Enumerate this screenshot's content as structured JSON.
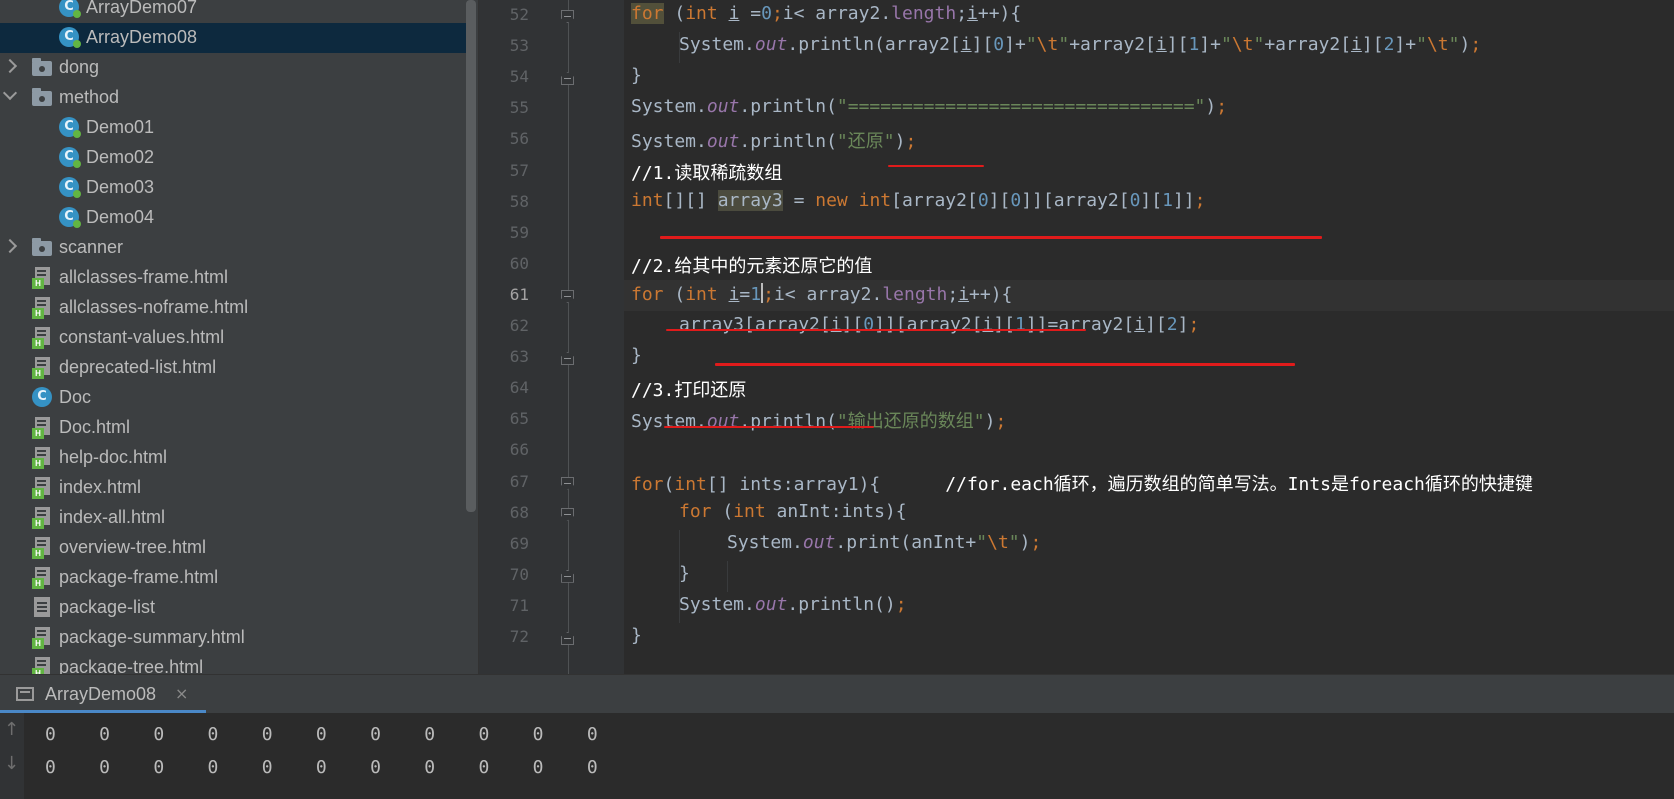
{
  "project_tree": [
    {
      "label": "ArrayDemo07",
      "type": "class",
      "indent": 2,
      "selected": false
    },
    {
      "label": "ArrayDemo08",
      "type": "class",
      "indent": 2,
      "selected": true
    },
    {
      "label": "dong",
      "type": "package",
      "indent": 1,
      "expanded": false
    },
    {
      "label": "method",
      "type": "package",
      "indent": 1,
      "expanded": true
    },
    {
      "label": "Demo01",
      "type": "class",
      "indent": 2
    },
    {
      "label": "Demo02",
      "type": "class",
      "indent": 2
    },
    {
      "label": "Demo03",
      "type": "class",
      "indent": 2
    },
    {
      "label": "Demo04",
      "type": "class",
      "indent": 2
    },
    {
      "label": "scanner",
      "type": "package",
      "indent": 1,
      "expanded": false
    },
    {
      "label": "allclasses-frame.html",
      "type": "html",
      "indent": 1
    },
    {
      "label": "allclasses-noframe.html",
      "type": "html",
      "indent": 1
    },
    {
      "label": "constant-values.html",
      "type": "html",
      "indent": 1
    },
    {
      "label": "deprecated-list.html",
      "type": "html",
      "indent": 1
    },
    {
      "label": "Doc",
      "type": "class-plain",
      "indent": 1
    },
    {
      "label": "Doc.html",
      "type": "html",
      "indent": 1
    },
    {
      "label": "help-doc.html",
      "type": "html",
      "indent": 1
    },
    {
      "label": "index.html",
      "type": "html",
      "indent": 1
    },
    {
      "label": "index-all.html",
      "type": "html",
      "indent": 1
    },
    {
      "label": "overview-tree.html",
      "type": "html",
      "indent": 1
    },
    {
      "label": "package-frame.html",
      "type": "html",
      "indent": 1
    },
    {
      "label": "package-list",
      "type": "text",
      "indent": 1
    },
    {
      "label": "package-summary.html",
      "type": "html",
      "indent": 1
    },
    {
      "label": "package-tree.html",
      "type": "html",
      "indent": 1
    }
  ],
  "editor": {
    "line_numbers": [
      "52",
      "53",
      "54",
      "55",
      "56",
      "57",
      "58",
      "59",
      "60",
      "61",
      "62",
      "63",
      "64",
      "65",
      "66",
      "67",
      "68",
      "69",
      "70",
      "71",
      "72"
    ],
    "current_line": "61",
    "code_lines": [
      "for (int i =0;i< array2.length;i++){",
      "System.out.println(array2[i][0]+\"\\t\"+array2[i][1]+\"\\t\"+array2[i][2]+\"\\t\");",
      "}",
      "System.out.println(\"================================\");",
      "System.out.println(\"还原\");",
      "//1.读取稀疏数组",
      "int[][] array3 = new int[array2[0][0]][array2[0][1]];",
      "",
      "//2.给其中的元素还原它的值",
      "for (int i=1;i< array2.length;i++){",
      "array3[array2[i][0]][array2[i][1]]=array2[i][2];",
      "}",
      "//3.打印还原",
      "System.out.println(\"输出还原的数组\");",
      "",
      "for(int[] ints:array1){      //for.each循环，遍历数组的简单写法。Ints是foreach循环的快捷键",
      "for (int anInt:ints){",
      "System.out.print(anInt+\"\\t\");",
      "}",
      "System.out.println();",
      "}"
    ]
  },
  "run_panel": {
    "tab_label": "ArrayDemo08",
    "close_glyph": "×",
    "output_lines": [
      "0    0    0    0    0    0    0    0    0    0    0",
      "0    0    0    0    0    0    0    0    0    0    0"
    ]
  },
  "colors": {
    "keyword": "#cc7832",
    "string": "#6a8759",
    "number": "#6897bb",
    "field": "#9876aa",
    "comment": "#ffffff",
    "annotation_red": "#e01b1b",
    "selection": "#0d293e"
  },
  "icons": [
    "chevron-right-icon",
    "chevron-down-icon",
    "package-folder-icon",
    "java-class-icon",
    "html-file-icon",
    "text-file-icon",
    "console-icon",
    "close-icon",
    "arrow-up-icon",
    "arrow-down-icon",
    "fold-marker-icon"
  ]
}
